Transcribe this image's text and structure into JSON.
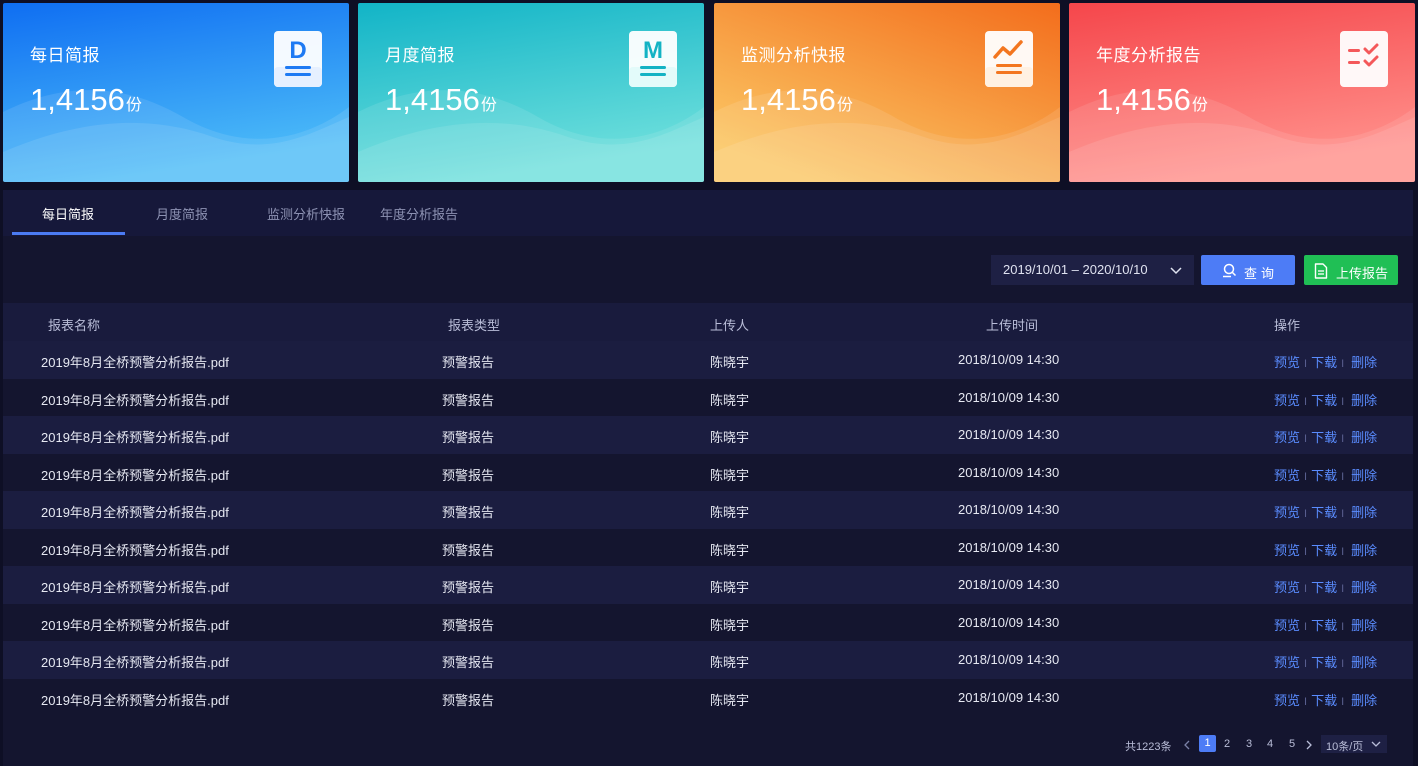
{
  "cards": [
    {
      "title": "每日简报",
      "count": "1,4156",
      "unit": "份",
      "icon": "daily-report-icon",
      "letter": "D",
      "colors": [
        "#1478f3",
        "#46b6f5"
      ]
    },
    {
      "title": "月度简报",
      "count": "1,4156",
      "unit": "份",
      "icon": "monthly-report-icon",
      "letter": "M",
      "colors": [
        "#14b6c6",
        "#5fdcd8"
      ]
    },
    {
      "title": "监测分析快报",
      "count": "1,4156",
      "unit": "份",
      "icon": "trend-report-icon",
      "letter": "",
      "colors": [
        "#f5701f",
        "#fbc05c"
      ]
    },
    {
      "title": "年度分析报告",
      "count": "1,4156",
      "unit": "份",
      "icon": "checklist-report-icon",
      "letter": "",
      "colors": [
        "#f54a4d",
        "#ff8a86"
      ]
    }
  ],
  "tabs": [
    "每日简报",
    "月度简报",
    "监测分析快报",
    "年度分析报告"
  ],
  "toolbar": {
    "date_range": "2019/10/01 – 2020/10/10",
    "query_label": "查询",
    "upload_label": "上传报告"
  },
  "table": {
    "headers": [
      "报表名称",
      "报表类型",
      "上传人",
      "上传时间",
      "操作"
    ],
    "rows": [
      {
        "name": "2019年8月全桥预警分析报告.pdf",
        "type": "预警报告",
        "user": "陈晓宇",
        "time": "2018/10/09 14:30"
      },
      {
        "name": "2019年8月全桥预警分析报告.pdf",
        "type": "预警报告",
        "user": "陈晓宇",
        "time": "2018/10/09 14:30"
      },
      {
        "name": "2019年8月全桥预警分析报告.pdf",
        "type": "预警报告",
        "user": "陈晓宇",
        "time": "2018/10/09 14:30"
      },
      {
        "name": "2019年8月全桥预警分析报告.pdf",
        "type": "预警报告",
        "user": "陈晓宇",
        "time": "2018/10/09 14:30"
      },
      {
        "name": "2019年8月全桥预警分析报告.pdf",
        "type": "预警报告",
        "user": "陈晓宇",
        "time": "2018/10/09 14:30"
      },
      {
        "name": "2019年8月全桥预警分析报告.pdf",
        "type": "预警报告",
        "user": "陈晓宇",
        "time": "2018/10/09 14:30"
      },
      {
        "name": "2019年8月全桥预警分析报告.pdf",
        "type": "预警报告",
        "user": "陈晓宇",
        "time": "2018/10/09 14:30"
      },
      {
        "name": "2019年8月全桥预警分析报告.pdf",
        "type": "预警报告",
        "user": "陈晓宇",
        "time": "2018/10/09 14:30"
      },
      {
        "name": "2019年8月全桥预警分析报告.pdf",
        "type": "预警报告",
        "user": "陈晓宇",
        "time": "2018/10/09 14:30"
      },
      {
        "name": "2019年8月全桥预警分析报告.pdf",
        "type": "预警报告",
        "user": "陈晓宇",
        "time": "2018/10/09 14:30"
      }
    ],
    "actions": {
      "preview": "预览",
      "download": "下载",
      "delete": "删除",
      "separator": "I"
    }
  },
  "pagination": {
    "total": "共1223条",
    "pages": [
      "1",
      "2",
      "3",
      "4",
      "5"
    ],
    "current": "1",
    "page_size": "10条/页"
  },
  "colors": {
    "accent": "#4d7cf6",
    "upload": "#20bf55",
    "link": "#5a8cff",
    "background": "#0e0f25"
  }
}
